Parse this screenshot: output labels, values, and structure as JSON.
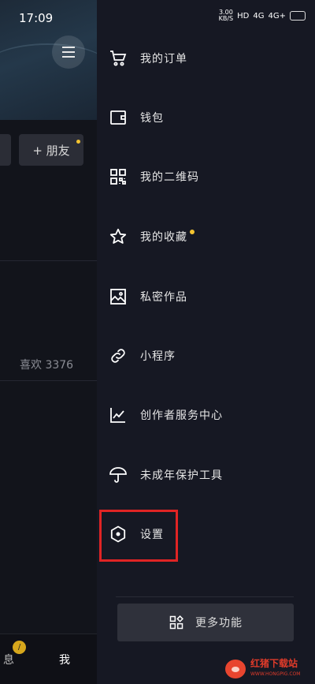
{
  "status_bar": {
    "time": "17:09",
    "network_speed": "3.00\nKB/S",
    "hd": "HD",
    "signal_1": "4G",
    "signal_2": "4G+"
  },
  "left_pane": {
    "add_friend_label": "+ 朋友",
    "likes_text": "喜欢 3376",
    "nav": {
      "message_label": "息",
      "me_label": "我"
    }
  },
  "drawer": {
    "items": [
      {
        "label": "我的订单",
        "icon": "cart-icon"
      },
      {
        "label": "钱包",
        "icon": "wallet-icon"
      },
      {
        "label": "我的二维码",
        "icon": "qr-code-icon"
      },
      {
        "label": "我的收藏",
        "icon": "star-icon"
      },
      {
        "label": "私密作品",
        "icon": "image-icon"
      },
      {
        "label": "小程序",
        "icon": "link-icon"
      },
      {
        "label": "创作者服务中心",
        "icon": "chart-icon"
      },
      {
        "label": "未成年保护工具",
        "icon": "umbrella-icon"
      },
      {
        "label": "设置",
        "icon": "settings-hexagon-icon"
      }
    ],
    "more_button_label": "更多功能"
  },
  "watermark": {
    "title": "红猪下载站",
    "url": "WWW.HONGPIG.COM"
  },
  "colors": {
    "background": "#161823",
    "accent_dot": "#f4c430",
    "highlight_border": "#e02424"
  }
}
